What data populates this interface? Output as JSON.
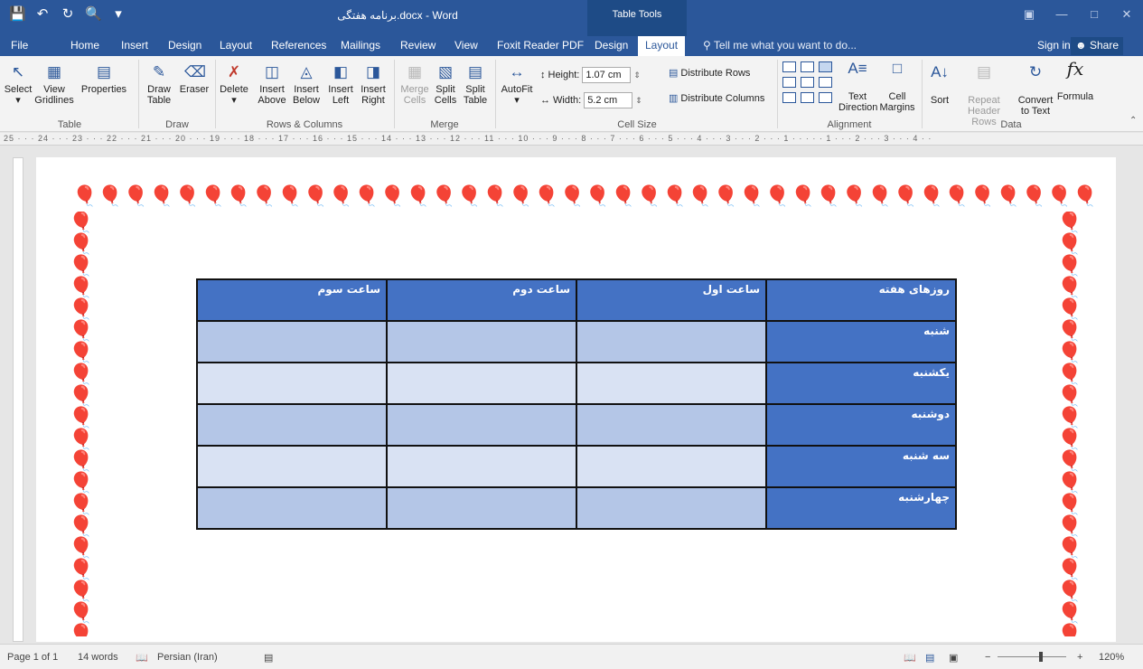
{
  "titlebar": {
    "title": "برنامه هفتگی.docx - Word",
    "context_tab_group": "Table Tools",
    "qat": [
      "save-icon",
      "undo-icon",
      "redo-icon",
      "print-preview-icon",
      "customize-qat-icon"
    ],
    "window_controls": [
      "ribbon-display-options-icon",
      "minimize-icon",
      "maximize-icon",
      "close-icon"
    ]
  },
  "tabs": [
    {
      "label": "File"
    },
    {
      "label": "Home"
    },
    {
      "label": "Insert"
    },
    {
      "label": "Design"
    },
    {
      "label": "Layout"
    },
    {
      "label": "References"
    },
    {
      "label": "Mailings"
    },
    {
      "label": "Review"
    },
    {
      "label": "View"
    },
    {
      "label": "Foxit Reader PDF"
    },
    {
      "label": "Design"
    },
    {
      "label": "Layout"
    }
  ],
  "tell_me": "Tell me what you want to do...",
  "signin": "Sign in",
  "share": "Share",
  "ribbon": {
    "table_group": {
      "label": "Table",
      "select": "Select",
      "view_gridlines": [
        "View",
        "Gridlines"
      ],
      "properties": "Properties"
    },
    "draw_group": {
      "label": "Draw",
      "draw_table": [
        "Draw",
        "Table"
      ],
      "eraser": "Eraser"
    },
    "delete": "Delete",
    "rows_cols_group": {
      "label": "Rows & Columns",
      "insert_above": [
        "Insert",
        "Above"
      ],
      "insert_below": [
        "Insert",
        "Below"
      ],
      "insert_left": [
        "Insert",
        "Left"
      ],
      "insert_right": [
        "Insert",
        "Right"
      ]
    },
    "merge_group": {
      "label": "Merge",
      "merge_cells": [
        "Merge",
        "Cells"
      ],
      "split_cells": [
        "Split",
        "Cells"
      ],
      "split_table": [
        "Split",
        "Table"
      ]
    },
    "autofit": "AutoFit",
    "cell_size_group": {
      "label": "Cell Size",
      "height_label": "Height:",
      "height_value": "1.07 cm",
      "width_label": "Width:",
      "width_value": "5.2 cm",
      "distribute_rows": "Distribute Rows",
      "distribute_columns": "Distribute Columns"
    },
    "alignment_group": {
      "label": "Alignment",
      "text_direction": [
        "Text",
        "Direction"
      ],
      "cell_margins": [
        "Cell",
        "Margins"
      ]
    },
    "data_group": {
      "label": "Data",
      "sort": "Sort",
      "repeat_header_rows": [
        "Repeat",
        "Header Rows"
      ],
      "convert_to_text": [
        "Convert",
        "to Text"
      ],
      "formula": "Formula"
    }
  },
  "ruler": "25 · · · 24 · · · 23 · · · 22 · · · 21 · · · 20 · · · 19 · · · 18 · · · 17 · · · 16 · · · 15 · · · 14 · · · 13 · · · 12 · · · 11 · · · 10 · · · 9 · · · 8 · · · 7 · · · 6 · · · 5 · · · 4 · · · 3 · · · 2 · · · 1 · · · · · 1 · · · 2 · · · 3 · · · 4 · ·",
  "table": {
    "header": [
      "روزهای هفته",
      "ساعت اول",
      "ساعت دوم",
      "ساعت سوم"
    ],
    "days": [
      "شنبه",
      "یکشنبه",
      "دوشنبه",
      "سه شنبه",
      "چهارشنبه"
    ]
  },
  "statusbar": {
    "page": "Page 1 of 1",
    "words": "14 words",
    "language": "Persian (Iran)",
    "zoom": "120%"
  }
}
